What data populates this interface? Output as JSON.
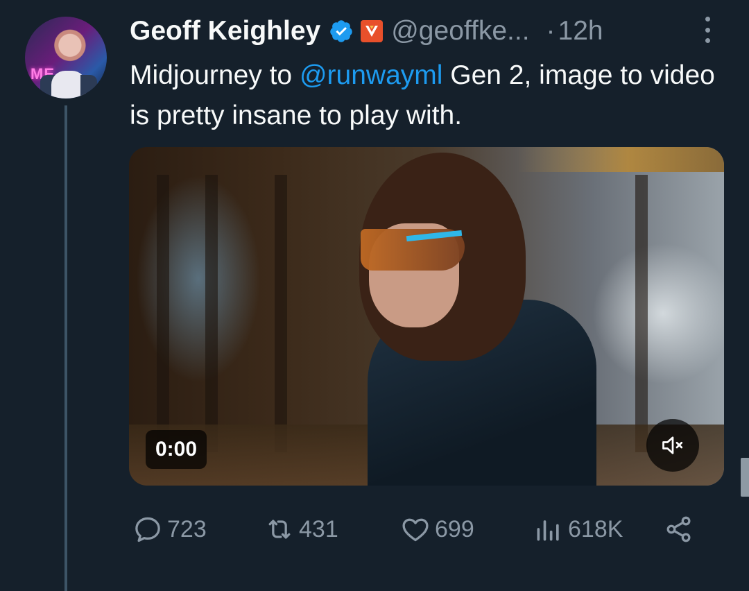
{
  "tweet": {
    "author_name": "Geoff Keighley",
    "handle": "@geoffke...",
    "separator": "·",
    "time": "12h",
    "text_before": "Midjourney to ",
    "mention": "@runwayml",
    "text_after": " Gen 2, image to video is pretty insane to play with.",
    "avatar_sign_text": "ME"
  },
  "video": {
    "timer": "0:00",
    "muted": true
  },
  "actions": {
    "replies": "723",
    "retweets": "431",
    "likes": "699",
    "views": "618K"
  },
  "colors": {
    "background": "#15202b",
    "text": "#f7f9f9",
    "muted": "#8b98a5",
    "accent": "#1d9bf0",
    "thread_line": "#3d5466"
  },
  "icons": [
    "verified-badge-icon",
    "affiliate-badge-icon",
    "more-icon",
    "mute-icon",
    "reply-icon",
    "retweet-icon",
    "like-icon",
    "views-icon",
    "share-icon"
  ]
}
